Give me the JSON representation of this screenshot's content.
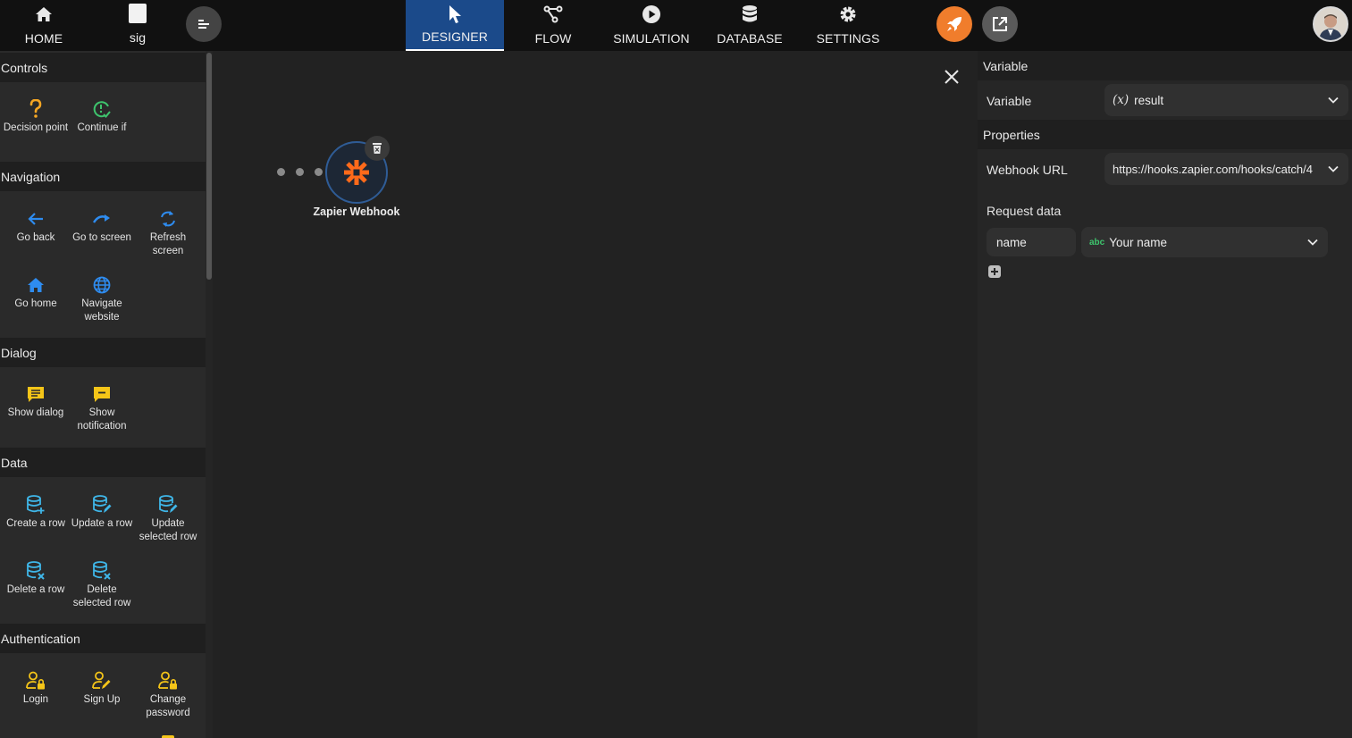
{
  "topbar": {
    "home_label": "HOME",
    "app_label": "sig",
    "tabs": [
      {
        "label": "DESIGNER",
        "icon": "cursor-icon",
        "active": true
      },
      {
        "label": "FLOW",
        "icon": "flow-icon",
        "active": false
      },
      {
        "label": "SIMULATION",
        "icon": "play-icon",
        "active": false
      },
      {
        "label": "DATABASE",
        "icon": "database-icon",
        "active": false
      },
      {
        "label": "SETTINGS",
        "icon": "gear-icon",
        "active": false
      }
    ],
    "publish_icon": "rocket-icon",
    "open_icon": "external-link-icon",
    "accent_active": "#1b4a8a",
    "accent_publish": "#f07d2c"
  },
  "left_panel": {
    "sections": [
      {
        "title": "Controls",
        "items": [
          {
            "label": "Decision point",
            "icon": "question-icon",
            "color": "#f5a623"
          },
          {
            "label": "Continue if",
            "icon": "check-clock-icon",
            "color": "#3ec46d"
          }
        ]
      },
      {
        "title": "Navigation",
        "items": [
          {
            "label": "Go back",
            "icon": "arrow-left-icon",
            "color": "#2e8cf0"
          },
          {
            "label": "Go to screen",
            "icon": "redo-icon",
            "color": "#2e8cf0"
          },
          {
            "label": "Refresh screen",
            "icon": "refresh-icon",
            "color": "#2e8cf0"
          },
          {
            "label": "Go home",
            "icon": "home-icon",
            "color": "#2e8cf0"
          },
          {
            "label": "Navigate website",
            "icon": "globe-icon",
            "color": "#2e8cf0"
          }
        ]
      },
      {
        "title": "Dialog",
        "items": [
          {
            "label": "Show dialog",
            "icon": "dialog-icon",
            "color": "#f5c518"
          },
          {
            "label": "Show notification",
            "icon": "notification-icon",
            "color": "#f5c518"
          }
        ]
      },
      {
        "title": "Data",
        "items": [
          {
            "label": "Create a row",
            "icon": "db-add-icon",
            "color": "#3fb6e8"
          },
          {
            "label": "Update a row",
            "icon": "db-edit-icon",
            "color": "#3fb6e8"
          },
          {
            "label": "Update selected row",
            "icon": "db-edit-icon",
            "color": "#3fb6e8"
          },
          {
            "label": "Delete a row",
            "icon": "db-delete-icon",
            "color": "#3fb6e8"
          },
          {
            "label": "Delete selected row",
            "icon": "db-delete-icon",
            "color": "#3fb6e8"
          }
        ]
      },
      {
        "title": "Authentication",
        "items": [
          {
            "label": "Login",
            "icon": "user-lock-icon",
            "color": "#f5c518"
          },
          {
            "label": "Sign Up",
            "icon": "user-edit-icon",
            "color": "#f5c518"
          },
          {
            "label": "Change password",
            "icon": "user-lock-icon",
            "color": "#f5c518"
          }
        ]
      }
    ]
  },
  "canvas": {
    "node_label": "Zapier Webhook",
    "node_icon": "zapier-asterisk-icon",
    "node_color": "#ff6a1a"
  },
  "right_panel": {
    "variable_section": "Variable",
    "variable_label": "Variable",
    "variable_prefix": "(x)",
    "variable_value": "result",
    "properties_section": "Properties",
    "webhook_label": "Webhook URL",
    "webhook_value": "https://hooks.zapier.com/hooks/catch/4",
    "request_label": "Request data",
    "request_rows": [
      {
        "key": "name",
        "type_badge": "abc",
        "value": "Your name"
      }
    ]
  }
}
